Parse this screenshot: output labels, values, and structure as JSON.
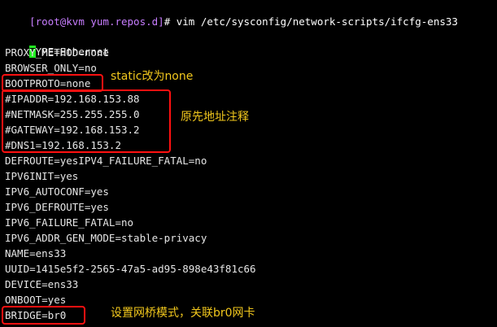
{
  "prompt": {
    "user_host_dir": "[root@kvm yum.repos.d]",
    "command": "# vim /etc/sysconfig/network-scripts/ifcfg-ens33"
  },
  "first_line": {
    "cursor_char": "T",
    "rest": "YPE=Ethernet"
  },
  "lines": [
    "PROXY_METHOD=none",
    "BROWSER_ONLY=no",
    "BOOTPROTO=none",
    "#IPADDR=192.168.153.88",
    "#NETMASK=255.255.255.0",
    "#GATEWAY=192.168.153.2",
    "#DNS1=192.168.153.2",
    "DEFROUTE=yesIPV4_FAILURE_FATAL=no",
    "IPV6INIT=yes",
    "IPV6_AUTOCONF=yes",
    "IPV6_DEFROUTE=yes",
    "IPV6_FAILURE_FATAL=no",
    "IPV6_ADDR_GEN_MODE=stable-privacy",
    "NAME=ens33",
    "UUID=1415e5f2-2565-47a5-ad95-898e43f81c66",
    "DEVICE=ens33",
    "ONBOOT=yes",
    "BRIDGE=br0"
  ],
  "annotations": {
    "bootproto_note": "static改为none",
    "addr_note": "原先地址注释",
    "bridge_note": "设置网桥模式，关联br0网卡"
  },
  "colors": {
    "background": "#000000",
    "text": "#e6e6e6",
    "prompt": "#c77dff",
    "cursor": "#22ee22",
    "highlight_box": "#ff1010",
    "annotation": "#f2c81d"
  }
}
